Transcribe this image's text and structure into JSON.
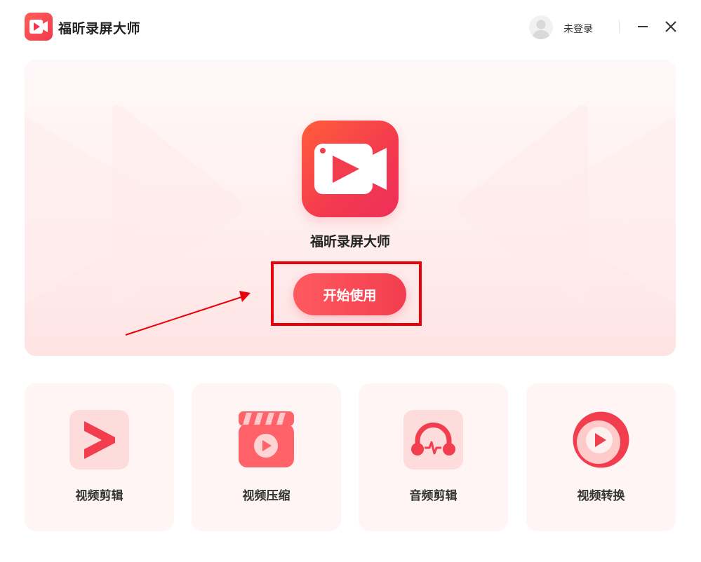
{
  "app": {
    "title": "福昕录屏大师"
  },
  "header": {
    "login_text": "未登录"
  },
  "hero": {
    "app_name": "福昕录屏大师",
    "start_button": "开始使用"
  },
  "tools": [
    {
      "label": "视频剪辑",
      "icon": "video-edit-icon"
    },
    {
      "label": "视频压缩",
      "icon": "video-compress-icon"
    },
    {
      "label": "音频剪辑",
      "icon": "audio-edit-icon"
    },
    {
      "label": "视频转换",
      "icon": "video-convert-icon"
    }
  ],
  "colors": {
    "brand": "#f23d4f",
    "annotation": "#e8000b",
    "card_bg": "#fff5f5"
  }
}
